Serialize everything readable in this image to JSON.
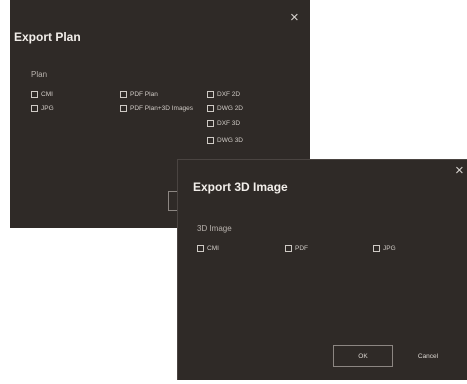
{
  "plan_dialog": {
    "title": "Export Plan",
    "close_glyph": "×",
    "section_label": "Plan",
    "options": [
      "CMI",
      "JPG",
      "PDF Plan",
      "PDF Plan+3D Images",
      "DXF 2D",
      "DWG 2D",
      "DXF 3D",
      "DWG 3D"
    ]
  },
  "image_dialog": {
    "title": "Export 3D Image",
    "close_glyph": "×",
    "section_label": "3D Image",
    "options": [
      "CMI",
      "PDF",
      "JPG"
    ],
    "ok_label": "OK",
    "cancel_label": "Cancel"
  }
}
